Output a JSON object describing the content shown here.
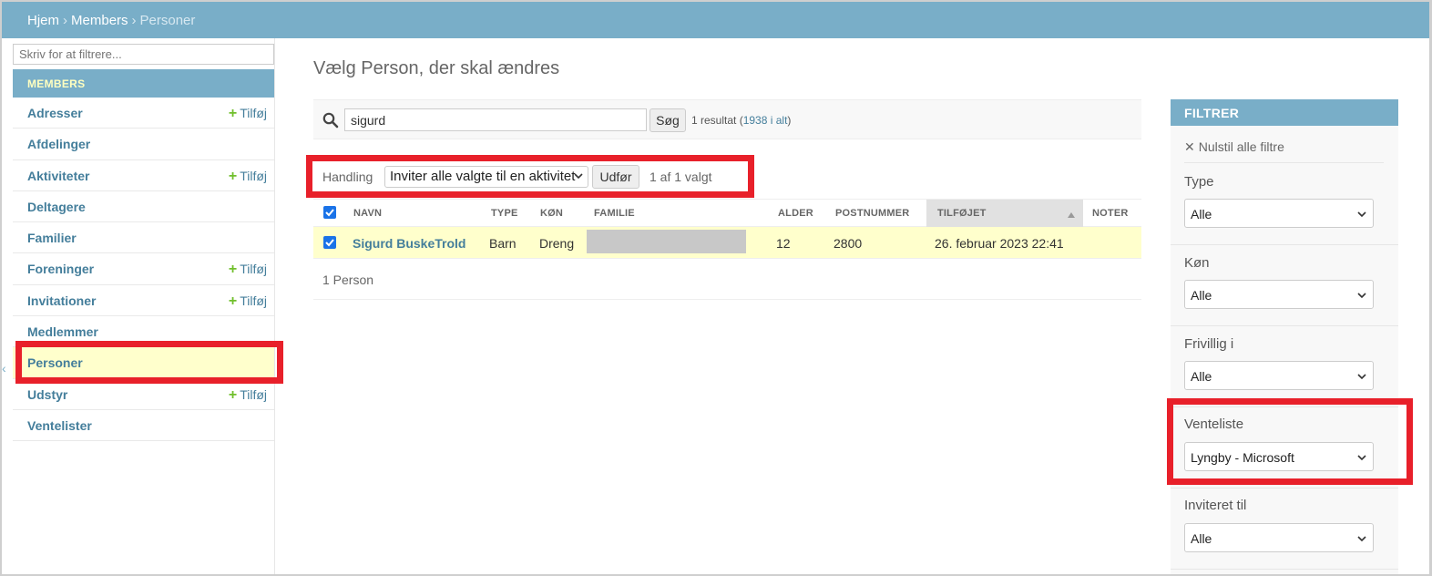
{
  "breadcrumbs": {
    "home": "Hjem",
    "app": "Members",
    "current": "Personer",
    "sep": "›"
  },
  "sidebar": {
    "filter_placeholder": "Skriv for at filtrere...",
    "module": "MEMBERS",
    "add_label": "Tilføj",
    "items": [
      {
        "label": "Adresser",
        "add": true
      },
      {
        "label": "Afdelinger",
        "add": false
      },
      {
        "label": "Aktiviteter",
        "add": true
      },
      {
        "label": "Deltagere",
        "add": false
      },
      {
        "label": "Familier",
        "add": false
      },
      {
        "label": "Foreninger",
        "add": true
      },
      {
        "label": "Invitationer",
        "add": true
      },
      {
        "label": "Medlemmer",
        "add": false
      },
      {
        "label": "Personer",
        "add": false,
        "active": true
      },
      {
        "label": "Udstyr",
        "add": true
      },
      {
        "label": "Ventelister",
        "add": false
      }
    ]
  },
  "content": {
    "title": "Vælg Person, der skal ændres",
    "search": {
      "value": "sigurd",
      "button": "Søg",
      "result_prefix": "1 resultat (",
      "result_link": "1938 i alt",
      "result_suffix": ")"
    },
    "actions": {
      "label": "Handling",
      "selected": "Inviter alle valgte til en aktivitet",
      "go": "Udfør",
      "count": "1 af 1 valgt"
    },
    "table": {
      "headers": {
        "name": "NAVN",
        "type": "TYPE",
        "gender": "KØN",
        "family": "FAMILIE",
        "age": "ALDER",
        "postal": "POSTNUMMER",
        "added": "TILFØJET",
        "notes": "NOTER"
      },
      "row": {
        "name": "Sigurd BuskeTrold",
        "type": "Barn",
        "gender": "Dreng",
        "age": "12",
        "postal": "2800",
        "added": "26. februar 2023 22:41"
      }
    },
    "paginator": "1 Person"
  },
  "filter": {
    "caption": "FILTRER",
    "clear": "Nulstil alle filtre",
    "sections": [
      {
        "label": "Type",
        "value": "Alle"
      },
      {
        "label": "Køn",
        "value": "Alle"
      },
      {
        "label": "Frivillig i",
        "value": "Alle"
      },
      {
        "label": "Venteliste",
        "value": "Lyngby - Microsoft"
      },
      {
        "label": "Inviteret til",
        "value": "Alle"
      }
    ]
  },
  "colors": {
    "header": "#79aec8",
    "link": "#447e9b",
    "highlight": "#ffffcc",
    "annotation": "#e8202a",
    "add": "#70bf2b"
  }
}
